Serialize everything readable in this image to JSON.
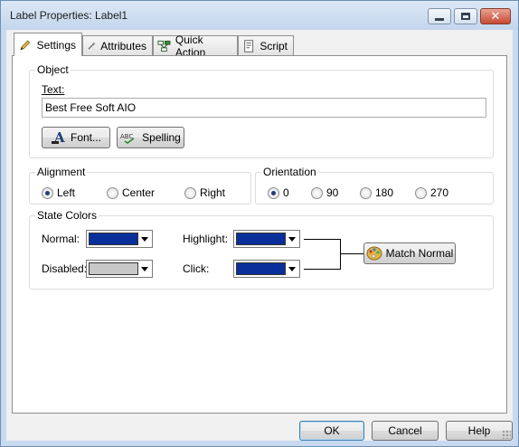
{
  "window": {
    "title": "Label Properties: Label1"
  },
  "tabs": [
    {
      "label": "Settings",
      "icon": "pencil-icon",
      "active": true
    },
    {
      "label": "Attributes",
      "icon": "wand-icon",
      "active": false
    },
    {
      "label": "Quick Action",
      "icon": "flowchart-icon",
      "active": false
    },
    {
      "label": "Script",
      "icon": "script-icon",
      "active": false
    }
  ],
  "object_group": {
    "title": "Object",
    "text_label": "Text:",
    "text_value": "Best Free Soft AIO",
    "font_button": "Font...",
    "spelling_button": "Spelling"
  },
  "alignment": {
    "title": "Alignment",
    "options": [
      "Left",
      "Center",
      "Right"
    ],
    "selected": "Left"
  },
  "orientation": {
    "title": "Orientation",
    "options": [
      "0",
      "90",
      "180",
      "270"
    ],
    "selected": "0"
  },
  "state_colors": {
    "title": "State Colors",
    "normal_label": "Normal:",
    "disabled_label": "Disabled:",
    "highlight_label": "Highlight:",
    "click_label": "Click:",
    "normal_color": "#0a2f9a",
    "disabled_color": "#c8c8c8",
    "highlight_color": "#0a2f9a",
    "click_color": "#0a2f9a",
    "match_normal_button": "Match Normal"
  },
  "footer": {
    "ok": "OK",
    "cancel": "Cancel",
    "help": "Help"
  }
}
